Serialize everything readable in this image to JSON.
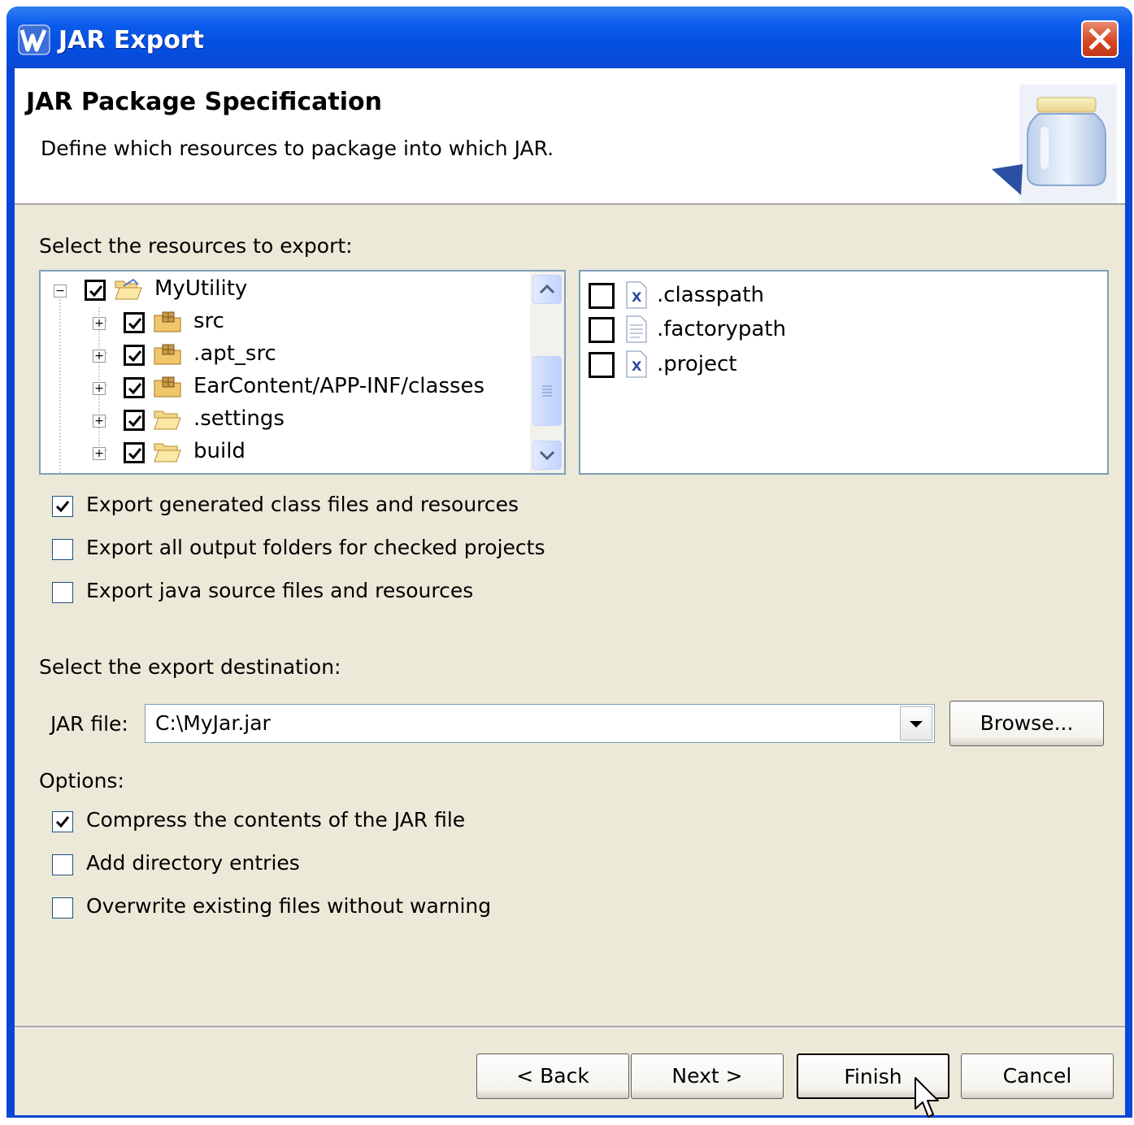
{
  "window": {
    "title": "JAR Export"
  },
  "header": {
    "title": "JAR Package Specification",
    "description": "Define which resources to package into which JAR."
  },
  "resources": {
    "label": "Select the resources to export:",
    "tree": [
      {
        "label": "MyUtility",
        "checked": true,
        "icon": "open-folder-icon",
        "expanded": true
      },
      {
        "label": "src",
        "checked": true,
        "icon": "package-folder-icon"
      },
      {
        "label": ".apt_src",
        "checked": true,
        "icon": "package-folder-icon"
      },
      {
        "label": "EarContent/APP-INF/classes",
        "checked": true,
        "icon": "package-folder-icon"
      },
      {
        "label": ".settings",
        "checked": true,
        "icon": "folder-icon"
      },
      {
        "label": "build",
        "checked": true,
        "icon": "folder-icon"
      }
    ],
    "files": [
      {
        "label": ".classpath",
        "checked": false,
        "icon": "xml-file-icon"
      },
      {
        "label": ".factorypath",
        "checked": false,
        "icon": "text-file-icon"
      },
      {
        "label": ".project",
        "checked": false,
        "icon": "xml-file-icon"
      }
    ]
  },
  "export_options": [
    {
      "label": "Export generated class files and resources",
      "checked": true
    },
    {
      "label": "Export all output folders for checked projects",
      "checked": false
    },
    {
      "label": "Export java source files and resources",
      "checked": false
    }
  ],
  "destination": {
    "label": "Select the export destination:",
    "jar_label": "JAR file:",
    "jar_value": "C:\\MyJar.jar",
    "browse_label": "Browse..."
  },
  "options": {
    "label": "Options:",
    "items": [
      {
        "label": "Compress the contents of the JAR file",
        "checked": true
      },
      {
        "label": "Add directory entries",
        "checked": false
      },
      {
        "label": "Overwrite existing files without warning",
        "checked": false
      }
    ]
  },
  "buttons": {
    "back": "< Back",
    "next": "Next >",
    "finish": "Finish",
    "cancel": "Cancel"
  }
}
